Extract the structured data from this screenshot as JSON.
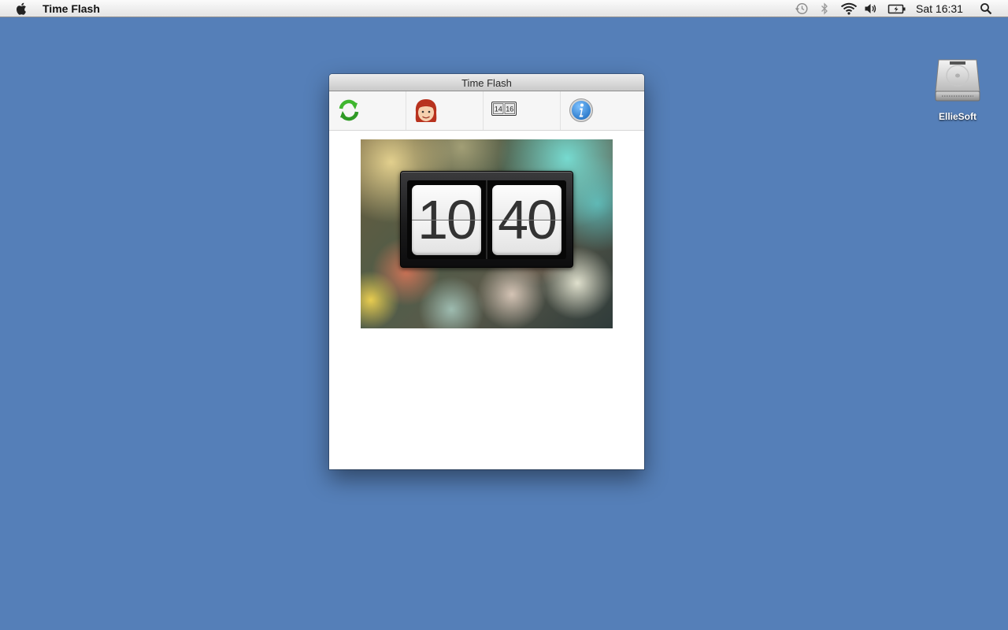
{
  "menubar": {
    "app_name": "Time Flash",
    "icons": [
      "apple-icon",
      "time-machine-icon",
      "bluetooth-icon",
      "wifi-icon",
      "volume-icon",
      "battery-icon",
      "spotlight-icon"
    ],
    "clock": "Sat 16:31"
  },
  "desktop": {
    "items": [
      {
        "label": "EllieSoft",
        "icon": "hard-drive-icon"
      }
    ]
  },
  "window": {
    "title": "Time Flash",
    "toolbar": [
      {
        "icon": "refresh-icon"
      },
      {
        "icon": "face-icon"
      },
      {
        "icon": "flip-clock-icon",
        "text": "14|16"
      },
      {
        "icon": "info-icon"
      }
    ],
    "clock_preview": {
      "hours": "10",
      "minutes": "40"
    }
  },
  "colors": {
    "desktop_background": "#557fb8",
    "refresh_green": "#3fb62f",
    "info_blue": "#1f6fc2"
  }
}
